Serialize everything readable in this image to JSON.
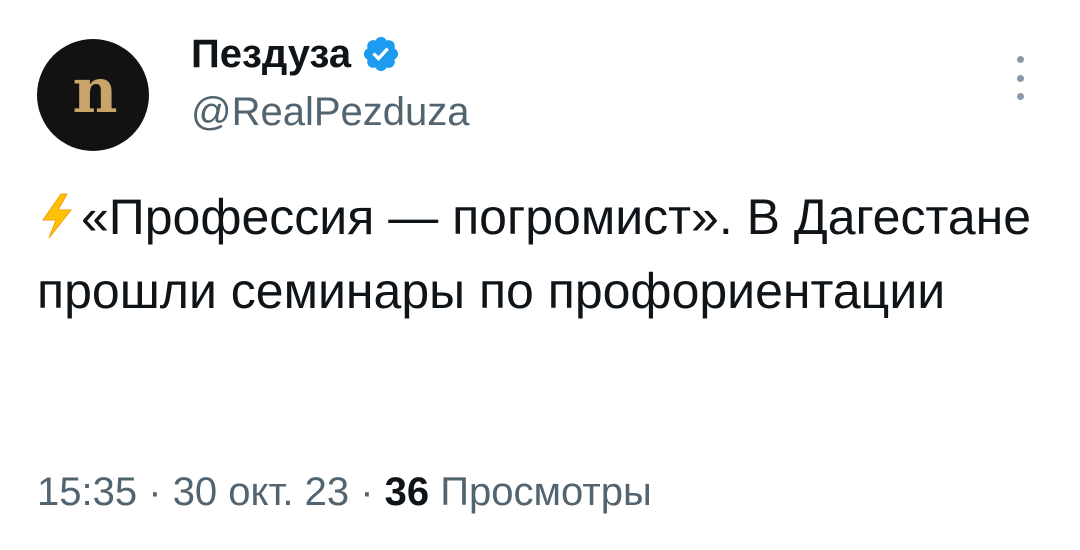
{
  "author": {
    "display_name": "Пездуза",
    "handle": "@RealPezduza",
    "verified": true,
    "avatar_letters": "n",
    "avatar_bg": "#121212",
    "avatar_fg": "#c9a46a"
  },
  "tweet": {
    "emoji": "lightning-icon",
    "text": "«Профессия — погромист». В Дагестане прошли семинары по профориентации"
  },
  "meta": {
    "time": "15:35",
    "separator": "·",
    "date": "30 окт. 23",
    "views_count": "36",
    "views_label": "Просмотры"
  },
  "colors": {
    "verified_blue": "#1d9bf0",
    "secondary_text": "#536471",
    "primary_text": "#0f1419"
  },
  "icons": {
    "verified": "verified-badge-icon",
    "more": "more-vertical-icon"
  }
}
